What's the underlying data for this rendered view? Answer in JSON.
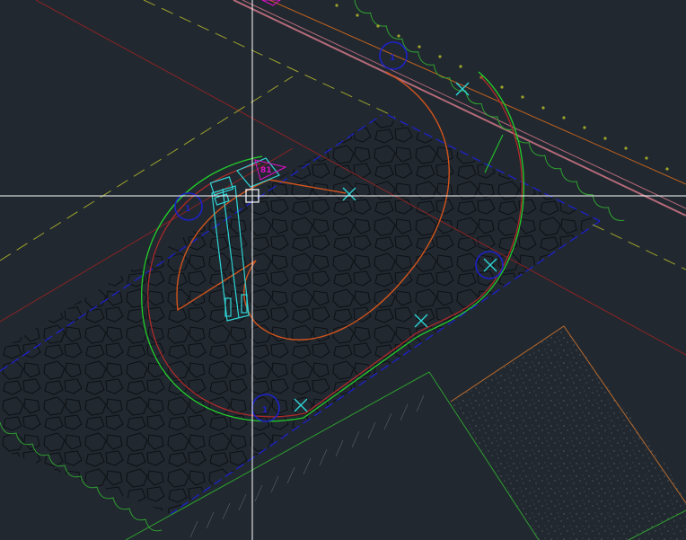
{
  "viewport": {
    "background": "#212830",
    "accent": "#ffffff"
  },
  "colors": {
    "red": "#b02a2a",
    "orange": "#d2541c",
    "green": "#22d02a",
    "cyan": "#2ed6d6",
    "blue": "#1d22c8",
    "magenta": "#e011c8",
    "yellow": "#9ea32a",
    "brown": "#b86a2c",
    "grass": "#2fa02f",
    "pattern": "#0d1014",
    "pink": "#b56a78"
  },
  "markers": {
    "marker_a": "1",
    "marker_b": "1",
    "marker_c": "1",
    "marker_d": "1"
  },
  "fixture_tag": "81",
  "icons": {
    "crosshair": "crosshair-cursor-icon",
    "pickbox": "pickbox-icon",
    "x_mark": "cross-marker-icon"
  }
}
